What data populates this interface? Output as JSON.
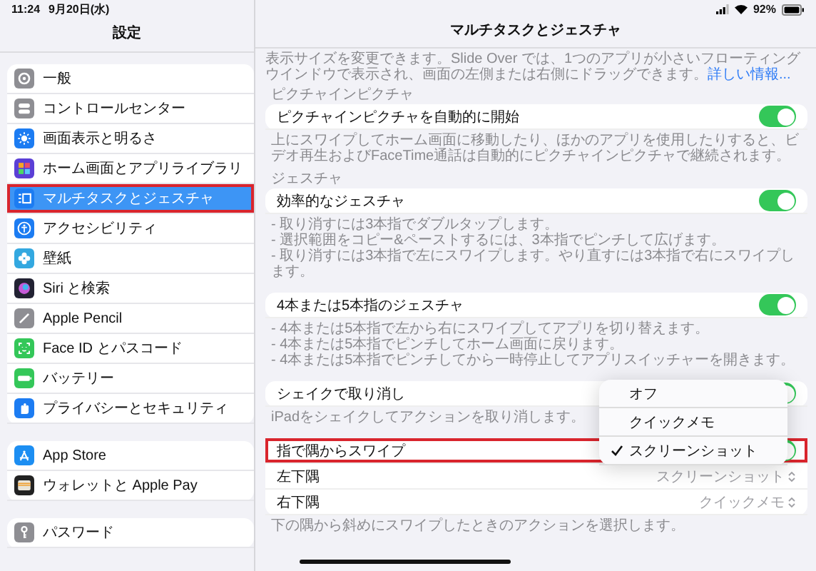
{
  "status_bar": {
    "time": "11:24",
    "date": "9月20日(水)",
    "battery": "92%"
  },
  "sidebar": {
    "title": "設定",
    "groups": [
      {
        "items": [
          {
            "label": "一般",
            "kind": "gear",
            "color": "#8e8e93",
            "selected": false,
            "highlighted": false
          },
          {
            "label": "コントロールセンター",
            "kind": "switches",
            "color": "#8e8e93",
            "selected": false,
            "highlighted": false
          },
          {
            "label": "画面表示と明るさ",
            "kind": "sun",
            "color": "#1c7cf2",
            "selected": false,
            "highlighted": false
          },
          {
            "label": "ホーム画面とアプリライブラリ",
            "kind": "grid",
            "color": "#5b3fd6",
            "selected": false,
            "highlighted": false
          },
          {
            "label": "マルチタスクとジェスチャ",
            "kind": "windows",
            "color": "#1c7cf2",
            "selected": true,
            "highlighted": true
          },
          {
            "label": "アクセシビリティ",
            "kind": "person",
            "color": "#1c7cf2",
            "selected": false,
            "highlighted": false
          },
          {
            "label": "壁紙",
            "kind": "flower",
            "color": "#33a8e0",
            "selected": false,
            "highlighted": false
          },
          {
            "label": "Siri と検索",
            "kind": "orb",
            "color": "#222233",
            "selected": false,
            "highlighted": false
          },
          {
            "label": "Apple Pencil",
            "kind": "pencil",
            "color": "#8e8e93",
            "selected": false,
            "highlighted": false
          },
          {
            "label": "Face ID とパスコード",
            "kind": "face",
            "color": "#34c759",
            "selected": false,
            "highlighted": false
          },
          {
            "label": "バッテリー",
            "kind": "battery",
            "color": "#34c759",
            "selected": false,
            "highlighted": false
          },
          {
            "label": "プライバシーとセキュリティ",
            "kind": "hand",
            "color": "#1c7cf2",
            "selected": false,
            "highlighted": false
          }
        ]
      },
      {
        "items": [
          {
            "label": "App Store",
            "kind": "astore",
            "color": "#1c8ef2",
            "selected": false,
            "highlighted": false
          },
          {
            "label": "ウォレットと Apple Pay",
            "kind": "wallet",
            "color": "#222222",
            "selected": false,
            "highlighted": false
          }
        ]
      },
      {
        "items": [
          {
            "label": "パスワード",
            "kind": "key",
            "color": "#8e8e93",
            "selected": false,
            "highlighted": false
          }
        ]
      }
    ]
  },
  "detail": {
    "title": "マルチタスクとジェスチャ",
    "intro": {
      "text": "表示サイズを変更できます。Slide Over では、1つのアプリが小さいフローティングウインドウで表示され、画面の左側または右側にドラッグできます。",
      "link": "詳しい情報..."
    },
    "sections": [
      {
        "header": "ピクチャインピクチャ",
        "rows": [
          {
            "kind": "toggle",
            "label": "ピクチャインピクチャを自動的に開始",
            "on": true,
            "highlighted": false
          }
        ],
        "notes": [
          "上にスワイプしてホーム画面に移動したり、ほかのアプリを使用したりすると、ビデオ再生およびFaceTime通話は自動的にピクチャインピクチャで継続されます。"
        ]
      },
      {
        "header": "ジェスチャ",
        "rows": [
          {
            "kind": "toggle",
            "label": "効率的なジェスチャ",
            "on": true,
            "highlighted": false
          }
        ],
        "notes": [
          "- 取り消すには3本指でダブルタップします。",
          "- 選択範囲をコピー&ペーストするには、3本指でピンチして広げます。",
          "- 取り消すには3本指で左にスワイプします。やり直すには3本指で右にスワイプします。"
        ]
      },
      {
        "rows": [
          {
            "kind": "toggle",
            "label": "4本または5本指のジェスチャ",
            "on": true,
            "highlighted": false
          }
        ],
        "notes": [
          "- 4本または5本指で左から右にスワイプしてアプリを切り替えます。",
          "- 4本または5本指でピンチしてホーム画面に戻ります。",
          "- 4本または5本指でピンチしてから一時停止してアプリスイッチャーを開きます。"
        ]
      },
      {
        "rows": [
          {
            "kind": "toggle",
            "label": "シェイクで取り消し",
            "on": true,
            "highlighted": false
          }
        ],
        "notes": [
          "iPadをシェイクしてアクションを取り消します。"
        ],
        "menu": {
          "items": [
            {
              "label": "オフ",
              "selected": false
            },
            {
              "label": "クイックメモ",
              "selected": false
            },
            {
              "label": "スクリーンショット",
              "selected": true
            }
          ]
        }
      },
      {
        "rows": [
          {
            "kind": "toggle",
            "label": "指で隅からスワイプ",
            "on": true,
            "highlighted": true
          },
          {
            "kind": "value",
            "label": "左下隅",
            "value": "スクリーンショット",
            "highlighted": false
          },
          {
            "kind": "value",
            "label": "右下隅",
            "value": "クイックメモ",
            "highlighted": false
          }
        ],
        "notes": [
          "下の隅から斜めにスワイプしたときのアクションを選択します。"
        ]
      }
    ]
  }
}
